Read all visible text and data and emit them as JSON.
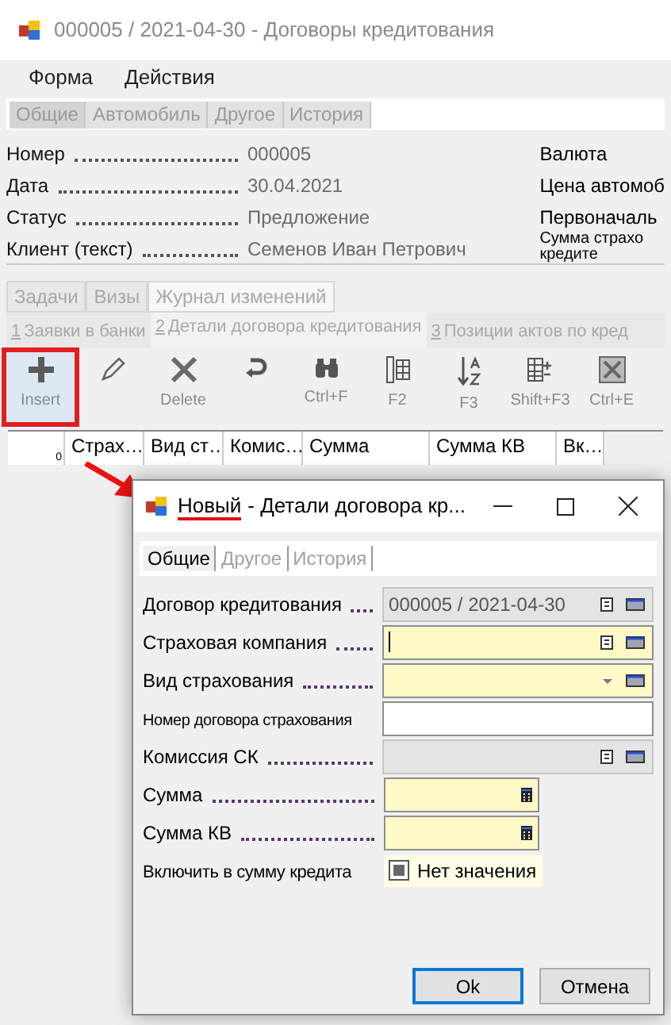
{
  "window": {
    "title": "000005 / 2021-04-30 - Договоры кредитования"
  },
  "menu": [
    "Форма",
    "Действия"
  ],
  "tabs": [
    {
      "label": "Общие",
      "selected": true
    },
    {
      "label": "Автомобиль",
      "selected": false
    },
    {
      "label": "Другое",
      "selected": false
    },
    {
      "label": "История",
      "selected": false
    }
  ],
  "fields": [
    {
      "label": "Номер",
      "value": "000005"
    },
    {
      "label": "Дата",
      "value": "30.04.2021"
    },
    {
      "label": "Статус",
      "value": "Предложение"
    },
    {
      "label": "Клиент (текст)",
      "value": "Семенов Иван Петрович"
    }
  ],
  "right_fields": [
    {
      "lines": [
        "Валюта"
      ]
    },
    {
      "lines": [
        "Цена автомоб"
      ]
    },
    {
      "lines": [
        "Первоначаль"
      ]
    },
    {
      "lines": [
        "Сумма страхо",
        "кредите"
      ]
    }
  ],
  "lower_tabs": [
    {
      "label": "Задачи",
      "selected": false
    },
    {
      "label": "Визы",
      "selected": false
    },
    {
      "label": "Журнал изменений",
      "selected": true
    }
  ],
  "sub_tabs": [
    {
      "number": "1",
      "label": "Заявки в банки",
      "selected": false
    },
    {
      "number": "2",
      "label": "Детали договора кредитования",
      "selected": true
    },
    {
      "number": "3",
      "label": "Позиции актов по кред",
      "selected": false
    }
  ],
  "toolbar": [
    {
      "kind": "plus",
      "label": "Insert",
      "highlighted": true
    },
    {
      "kind": "pencil",
      "highlighted": false
    },
    {
      "kind": "cross",
      "label": "Delete",
      "highlighted": false
    },
    {
      "kind": "undo",
      "highlighted": false
    },
    {
      "kind": "binoculars",
      "label": "Ctrl+F",
      "highlighted": false
    },
    {
      "kind": "columns",
      "label": "F2",
      "highlighted": false
    },
    {
      "kind": "sort",
      "label": "F3",
      "highlighted": false
    },
    {
      "kind": "grid",
      "label": "Shift+F3",
      "highlighted": false
    },
    {
      "kind": "excel",
      "label": "Ctrl+E",
      "highlighted": false
    }
  ],
  "grid": {
    "row_header": "0",
    "columns": [
      "Страх…",
      "Вид ст…",
      "Комис…",
      "Сумма",
      "Сумма КВ",
      "Вк…"
    ]
  },
  "dialog": {
    "title_marked": "Новый",
    "title": "- Детали договора кр...",
    "tabs": [
      {
        "label": "Общие",
        "selected": true
      },
      {
        "label": "Другое",
        "selected": false
      },
      {
        "label": "История",
        "selected": false
      }
    ],
    "fields": [
      {
        "kind": "lookup",
        "label": "Договор кредитования",
        "value": "000005 / 2021-04-30",
        "required": false,
        "readonly": true
      },
      {
        "kind": "lookup",
        "label": "Страховая компания",
        "required": true,
        "readonly": false,
        "focused": true
      },
      {
        "kind": "dropdown",
        "label": "Вид страхования",
        "required": true,
        "readonly": false
      },
      {
        "kind": "text",
        "label": "Номер договора страхования",
        "required": false,
        "readonly": false
      },
      {
        "kind": "lookup",
        "label": "Комиссия СК",
        "required": false,
        "readonly": true
      },
      {
        "kind": "calc",
        "label": "Сумма",
        "required": true,
        "readonly": false
      },
      {
        "kind": "calc",
        "label": "Сумма КВ",
        "required": true,
        "readonly": false
      },
      {
        "kind": "checkbox",
        "label": "Включить в сумму кредита",
        "value": "Нет значения",
        "indeterminate": true
      }
    ],
    "buttons": [
      {
        "label": "Ok",
        "default": true
      },
      {
        "label": "Отмена",
        "default": false
      }
    ]
  }
}
